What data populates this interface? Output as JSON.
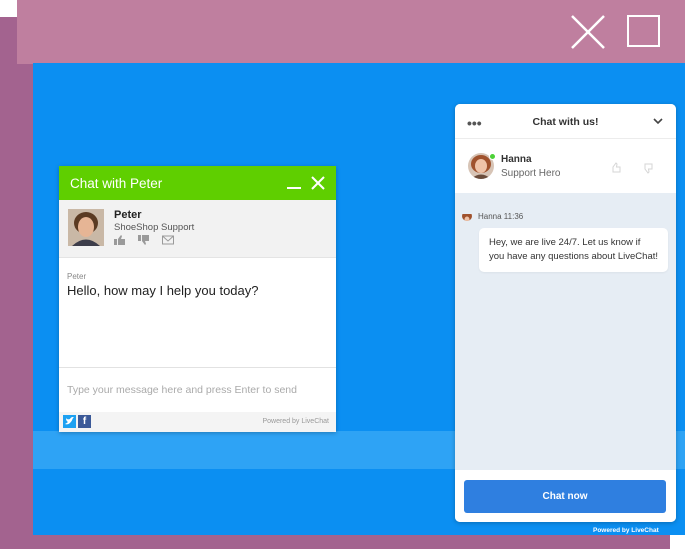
{
  "colors": {
    "back_panel": "#a3638f",
    "top_panel": "#bf7f9f",
    "stage_blue": "#0b8ff2",
    "left_header_green": "#5fcf00",
    "chat_now_blue": "#2f7fe0"
  },
  "window_controls": {
    "close_icon": "close-icon",
    "maximize_icon": "maximize-icon"
  },
  "left_widget": {
    "title": "Chat with Peter",
    "agent_name": "Peter",
    "agent_role": "ShoeShop Support",
    "message_author": "Peter",
    "message_text": "Hello, how may I help you today?",
    "input_placeholder": "Type your message here and press Enter to send",
    "powered_by": "Powered by LiveChat",
    "facebook_glyph": "f"
  },
  "right_widget": {
    "header_title": "Chat with us!",
    "menu_glyph": "•••",
    "agent_name": "Hanna",
    "agent_role": "Support Hero",
    "message_meta": "Hanna 11:36",
    "message_text": "Hey, we are live 24/7. Let us know if you have any questions about LiveChat!",
    "button_label": "Chat now",
    "powered_by": "Powered by LiveChat"
  }
}
